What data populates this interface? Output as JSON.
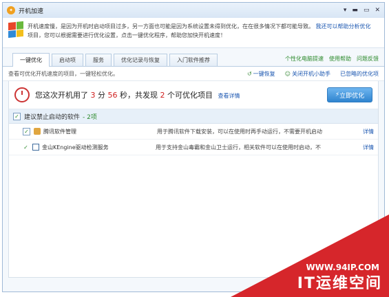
{
  "window": {
    "title": "开机加速",
    "controls": [
      "▾",
      "▬",
      "▭",
      "✕"
    ]
  },
  "banner": {
    "line1": "开机速度慢，是因为开机时启动项目过多，另一方面也可能是因为系统设置未得到优化，在在很多情况下都可能导致。",
    "line1_link": "我还可以帮助分析优化",
    "line2": "项目，您可以根据需要进行优化设置，点击一键优化程序，帮助您加快开机速度！"
  },
  "tabs": [
    {
      "label": "一键优化",
      "active": true
    },
    {
      "label": "启动项",
      "active": false
    },
    {
      "label": "服务",
      "active": false
    },
    {
      "label": "优化记录与恢复",
      "active": false
    },
    {
      "label": "入门软件推荐",
      "active": false
    }
  ],
  "tab_links": [
    "个性化电脑提速",
    "使用帮助",
    "问题反馈"
  ],
  "toolbar": {
    "description": "查看可优化开机速度的项目，一键轻松优化。",
    "actions": [
      "一键恢复",
      "关闭开机小助手",
      "已忽略的优化项"
    ]
  },
  "summary": {
    "prefix": "您这次开机用了",
    "minutes": "3",
    "minutes_unit": "分",
    "seconds": "56",
    "seconds_unit": "秒，共发现",
    "count": "2",
    "suffix": "个可优化项目",
    "detail_link": "查看详情",
    "button": "立即优化"
  },
  "group": {
    "title": "建议禁止启动的软件",
    "count": "- 2项"
  },
  "rows": [
    {
      "name": "腾讯软件管理",
      "desc": "用于腾讯软件下载安装，可以在使用时再手动运行，不需要开机启动",
      "link": "详情"
    },
    {
      "name": "金山KEngine驱动检测服务",
      "desc": "用于支持金山毒霸和金山卫士运行，相关软件可以在使用时启动，不…",
      "link": "详情"
    }
  ],
  "watermark": {
    "url": "WWW.94IP.COM",
    "text": "IT运维空间"
  },
  "colors": {
    "accent": "#1a56b0",
    "green": "#2c8a2c",
    "red": "#d02020",
    "watermark": "#d6262b"
  }
}
